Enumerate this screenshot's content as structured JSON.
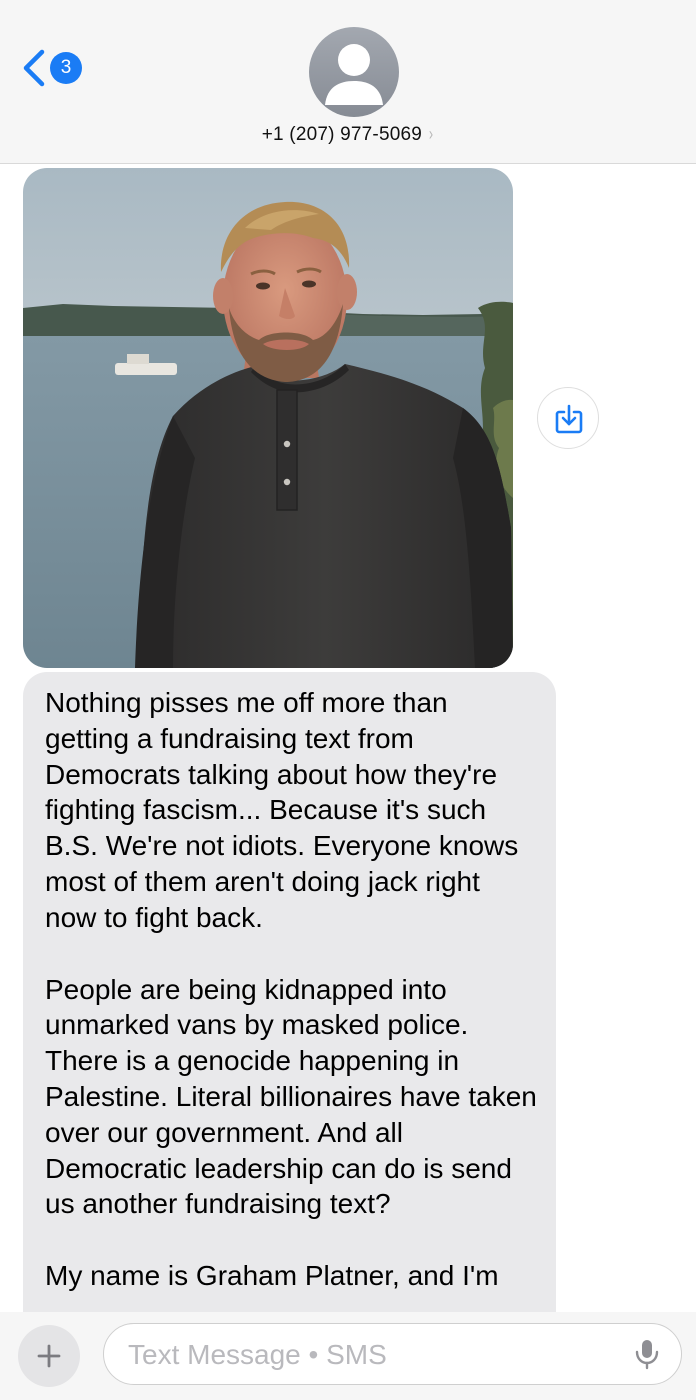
{
  "header": {
    "back_badge_count": "3",
    "contact_number": "+1 (207) 977-5069",
    "contact_chevron": "›"
  },
  "photo": {
    "icon": "photo-attachment",
    "description_icon": "save-to-photos-icon"
  },
  "message": {
    "paragraphs": [
      "Nothing pisses me off more than getting a fundraising text from Democrats talking about how they're fighting fascism... Because it's such B.S. We're not idiots. Everyone knows most of them aren't doing jack right now to fight back.",
      "People are being kidnapped into unmarked vans by masked police. There is a genocide happening in Palestine. Literal billionaires have taken over our government. And all Democratic leadership can do is send us another fundraising text?",
      "My name is Graham Platner, and I'm"
    ]
  },
  "compose": {
    "placeholder": "Text Message • SMS",
    "value": ""
  },
  "colors": {
    "accent": "#1a7cf5",
    "incoming_bubble": "#e9e9eb",
    "header_bg": "#f6f6f6"
  }
}
